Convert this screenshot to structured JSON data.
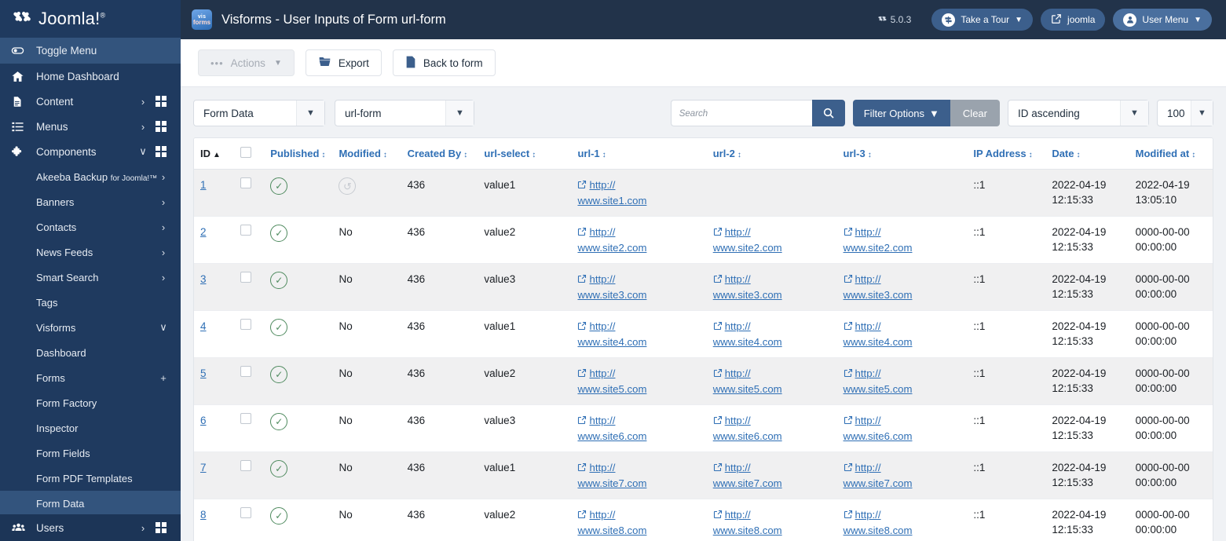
{
  "sidebar": {
    "brand": {
      "name": "Joomla!",
      "trademark": "®"
    },
    "items": [
      {
        "label": "Toggle Menu",
        "icon": "toggle-icon",
        "state": "active",
        "chev": "",
        "grid": false
      },
      {
        "label": "Home Dashboard",
        "icon": "home-icon",
        "chev": "",
        "grid": false
      },
      {
        "label": "Content",
        "icon": "document-icon",
        "chev": "›",
        "grid": true
      },
      {
        "label": "Menus",
        "icon": "list-icon",
        "chev": "›",
        "grid": true
      },
      {
        "label": "Components",
        "icon": "puzzle-icon",
        "chev": "∨",
        "grid": true
      },
      {
        "label": "Akeeba Backup",
        "sublabel": "for Joomla!™",
        "sub": true,
        "chev": "›"
      },
      {
        "label": "Banners",
        "sub": true,
        "chev": "›"
      },
      {
        "label": "Contacts",
        "sub": true,
        "chev": "›"
      },
      {
        "label": "News Feeds",
        "sub": true,
        "chev": "›"
      },
      {
        "label": "Smart Search",
        "sub": true,
        "chev": "›"
      },
      {
        "label": "Tags",
        "sub": true,
        "chev": ""
      },
      {
        "label": "Visforms",
        "sub": true,
        "chev": "∨"
      },
      {
        "label": "Dashboard",
        "sub2": true,
        "chev": ""
      },
      {
        "label": "Forms",
        "sub2": true,
        "chev": "+"
      },
      {
        "label": "Form Factory",
        "sub2": true,
        "chev": ""
      },
      {
        "label": "Inspector",
        "sub2": true,
        "chev": ""
      },
      {
        "label": "Form Fields",
        "sub2": true,
        "chev": ""
      },
      {
        "label": "Form PDF Templates",
        "sub2": true,
        "chev": ""
      },
      {
        "label": "Form Data",
        "sub2": true,
        "chev": "",
        "selected": true
      }
    ],
    "bottom": {
      "label": "Users",
      "icon": "users-icon",
      "chev": "›",
      "grid": true
    }
  },
  "topbar": {
    "logo_line1": "vis",
    "logo_line2": "forms",
    "title": "Visforms - User Inputs of Form url-form",
    "version": "5.0.3",
    "take_a_tour": "Take a Tour",
    "joomla_link": "joomla",
    "user_menu": "User Menu"
  },
  "toolbar": {
    "actions_label": "Actions",
    "export_label": "Export",
    "back_label": "Back to form"
  },
  "filters": {
    "form_data_select": "Form Data",
    "form_select": "url-form",
    "search_placeholder": "Search",
    "search_value": "",
    "filter_options_label": "Filter Options",
    "clear_label": "Clear",
    "sort_value": "ID ascending",
    "limit_value": "100"
  },
  "table": {
    "columns": [
      {
        "key": "id",
        "label": "ID",
        "sorted": "asc"
      },
      {
        "key": "check",
        "label": ""
      },
      {
        "key": "published",
        "label": "Published"
      },
      {
        "key": "modified",
        "label": "Modified"
      },
      {
        "key": "created_by",
        "label": "Created By"
      },
      {
        "key": "url_select",
        "label": "url-select"
      },
      {
        "key": "url_1",
        "label": "url-1"
      },
      {
        "key": "url_2",
        "label": "url-2"
      },
      {
        "key": "url_3",
        "label": "url-3"
      },
      {
        "key": "ip",
        "label": "IP Address"
      },
      {
        "key": "date",
        "label": "Date"
      },
      {
        "key": "modified_at",
        "label": "Modified at"
      }
    ],
    "rows": [
      {
        "id": "1",
        "published": "yes",
        "modified": "undo-icon",
        "created_by": "436",
        "url_select": "value1",
        "url_1": "http://www.site1.com",
        "url_2": "",
        "url_3": "",
        "ip": "::1",
        "date": "2022-04-19 12:15:33",
        "modified_at": "2022-04-19 13:05:10"
      },
      {
        "id": "2",
        "published": "yes",
        "modified": "No",
        "created_by": "436",
        "url_select": "value2",
        "url_1": "http://www.site2.com",
        "url_2": "http://www.site2.com",
        "url_3": "http://www.site2.com",
        "ip": "::1",
        "date": "2022-04-19 12:15:33",
        "modified_at": "0000-00-00 00:00:00"
      },
      {
        "id": "3",
        "published": "yes",
        "modified": "No",
        "created_by": "436",
        "url_select": "value3",
        "url_1": "http://www.site3.com",
        "url_2": "http://www.site3.com",
        "url_3": "http://www.site3.com",
        "ip": "::1",
        "date": "2022-04-19 12:15:33",
        "modified_at": "0000-00-00 00:00:00"
      },
      {
        "id": "4",
        "published": "yes",
        "modified": "No",
        "created_by": "436",
        "url_select": "value1",
        "url_1": "http://www.site4.com",
        "url_2": "http://www.site4.com",
        "url_3": "http://www.site4.com",
        "ip": "::1",
        "date": "2022-04-19 12:15:33",
        "modified_at": "0000-00-00 00:00:00"
      },
      {
        "id": "5",
        "published": "yes",
        "modified": "No",
        "created_by": "436",
        "url_select": "value2",
        "url_1": "http://www.site5.com",
        "url_2": "http://www.site5.com",
        "url_3": "http://www.site5.com",
        "ip": "::1",
        "date": "2022-04-19 12:15:33",
        "modified_at": "0000-00-00 00:00:00"
      },
      {
        "id": "6",
        "published": "yes",
        "modified": "No",
        "created_by": "436",
        "url_select": "value3",
        "url_1": "http://www.site6.com",
        "url_2": "http://www.site6.com",
        "url_3": "http://www.site6.com",
        "ip": "::1",
        "date": "2022-04-19 12:15:33",
        "modified_at": "0000-00-00 00:00:00"
      },
      {
        "id": "7",
        "published": "yes",
        "modified": "No",
        "created_by": "436",
        "url_select": "value1",
        "url_1": "http://www.site7.com",
        "url_2": "http://www.site7.com",
        "url_3": "http://www.site7.com",
        "ip": "::1",
        "date": "2022-04-19 12:15:33",
        "modified_at": "0000-00-00 00:00:00"
      },
      {
        "id": "8",
        "published": "yes",
        "modified": "No",
        "created_by": "436",
        "url_select": "value2",
        "url_1": "http://www.site8.com",
        "url_2": "http://www.site8.com",
        "url_3": "http://www.site8.com",
        "ip": "::1",
        "date": "2022-04-19 12:15:33",
        "modified_at": "0000-00-00 00:00:00"
      }
    ]
  },
  "colors": {
    "sidebar_bg": "#1f3a5f",
    "sidebar_active": "#33547d",
    "topbar_bg": "#22334a",
    "accent_blue": "#3c5f8c",
    "link_blue": "#2f6fb5",
    "published_green": "#4e8a5e",
    "row_stripe": "#f0f0f1",
    "page_bg": "#f0f2f5"
  }
}
